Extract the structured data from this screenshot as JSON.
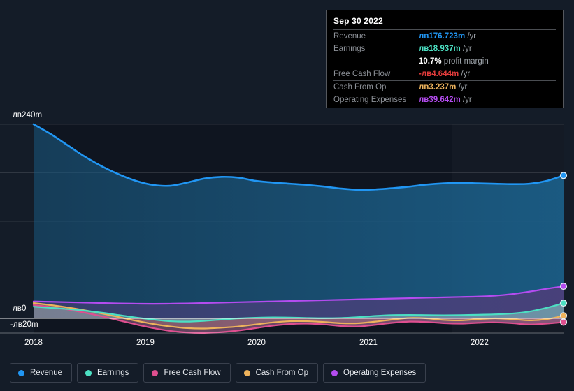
{
  "chart_data": {
    "type": "area",
    "title": "",
    "xlabel": "",
    "ylabel": "",
    "currency_symbol": "лв",
    "unit_suffix": "m",
    "ylim": [
      -20,
      240
    ],
    "gridlines": [
      240,
      180,
      120,
      60,
      0
    ],
    "yticks": [
      "лв240m",
      "лв0",
      "-лв20m"
    ],
    "grid": true,
    "legend_position": "bottom",
    "x_tick_labels": [
      "2018",
      "2019",
      "2020",
      "2021",
      "2022"
    ],
    "x_range_start": "2017-09-30",
    "x_range_end": "2022-09-30",
    "highlight_band_start_label": "2021-12-31",
    "series": [
      {
        "name": "Revenue",
        "color": "#2196f3",
        "fill": "#1b5d86",
        "values": [
          240.0,
          228.0,
          214.0,
          200.0,
          188.0,
          178.0,
          170.0,
          165.0,
          164.0,
          168.0,
          173.0,
          175.0,
          174.0,
          170.0,
          168.0,
          166.5,
          165.0,
          163.0,
          160.5,
          159.0,
          159.5,
          161.0,
          163.0,
          165.5,
          167.0,
          167.5,
          167.0,
          166.5,
          166.0,
          166.5,
          170.0,
          176.723
        ],
        "end_value": 176.723
      },
      {
        "name": "Earnings",
        "color": "#4ce0c3",
        "fill": "#6f97a8",
        "values": [
          14.5,
          13.0,
          11.5,
          9.5,
          7.0,
          4.0,
          1.0,
          -1.5,
          -3.5,
          -4.0,
          -3.0,
          -1.5,
          0.0,
          0.8,
          1.2,
          1.0,
          0.5,
          0.2,
          0.5,
          1.5,
          3.0,
          4.0,
          4.2,
          4.0,
          3.8,
          4.0,
          4.5,
          5.0,
          6.0,
          8.5,
          13.0,
          18.937
        ],
        "end_value": 18.937
      },
      {
        "name": "Free Cash Flow",
        "color": "#df4f90",
        "fill": "#8e5a7e",
        "values": [
          16.5,
          14.0,
          11.0,
          7.0,
          2.5,
          -2.5,
          -7.5,
          -12.0,
          -15.5,
          -17.5,
          -18.0,
          -17.0,
          -15.0,
          -12.0,
          -9.0,
          -7.0,
          -6.5,
          -7.5,
          -9.5,
          -10.0,
          -8.0,
          -5.5,
          -4.0,
          -4.5,
          -6.0,
          -6.5,
          -5.5,
          -5.0,
          -6.0,
          -7.5,
          -6.5,
          -4.644
        ],
        "end_value": -4.644
      },
      {
        "name": "Cash From Op",
        "color": "#eeb35c",
        "fill": "#9d7f63",
        "values": [
          19.0,
          16.5,
          13.5,
          10.0,
          6.0,
          1.5,
          -3.0,
          -7.0,
          -10.0,
          -12.0,
          -12.5,
          -11.5,
          -10.0,
          -7.5,
          -5.0,
          -3.5,
          -3.5,
          -4.5,
          -6.0,
          -6.0,
          -4.0,
          -1.5,
          0.5,
          0.0,
          -2.0,
          -2.5,
          -1.0,
          0.0,
          -1.0,
          -2.5,
          -1.0,
          3.237
        ],
        "end_value": 3.237
      },
      {
        "name": "Operating Expenses",
        "color": "#b44cf0",
        "fill": "#4a3f7a",
        "values": [
          21.0,
          20.5,
          20.0,
          19.5,
          19.0,
          18.5,
          18.2,
          18.0,
          18.2,
          18.5,
          19.0,
          19.5,
          20.0,
          20.5,
          21.0,
          21.5,
          22.0,
          22.5,
          23.0,
          23.5,
          24.0,
          24.5,
          25.0,
          25.5,
          26.0,
          26.5,
          27.0,
          28.0,
          30.0,
          33.0,
          36.5,
          39.642
        ],
        "end_value": 39.642
      }
    ]
  },
  "tooltip": {
    "title": "Sep 30 2022",
    "rows": [
      {
        "key": "Revenue",
        "value": "лв176.723m",
        "unit": "/yr",
        "color": "#2196f3"
      },
      {
        "key": "Earnings",
        "value": "лв18.937m",
        "unit": "/yr",
        "color": "#4ce0c3"
      },
      {
        "key": "",
        "value": "10.7%",
        "unit": "profit margin",
        "color": "#ffffff",
        "no_rule": true
      },
      {
        "key": "Free Cash Flow",
        "value": "-лв4.644m",
        "unit": "/yr",
        "color": "#e23c3c"
      },
      {
        "key": "Cash From Op",
        "value": "лв3.237m",
        "unit": "/yr",
        "color": "#eeb35c"
      },
      {
        "key": "Operating Expenses",
        "value": "лв39.642m",
        "unit": "/yr",
        "color": "#b44cf0"
      }
    ]
  },
  "legend": {
    "items": [
      {
        "label": "Revenue",
        "color": "#2196f3"
      },
      {
        "label": "Earnings",
        "color": "#4ce0c3"
      },
      {
        "label": "Free Cash Flow",
        "color": "#df4f90"
      },
      {
        "label": "Cash From Op",
        "color": "#eeb35c"
      },
      {
        "label": "Operating Expenses",
        "color": "#b44cf0"
      }
    ]
  },
  "axis": {
    "y_top_label": "лв240m",
    "y_zero_label": "лв0",
    "y_bottom_label": "-лв20m",
    "x_labels": [
      "2018",
      "2019",
      "2020",
      "2021",
      "2022"
    ]
  }
}
